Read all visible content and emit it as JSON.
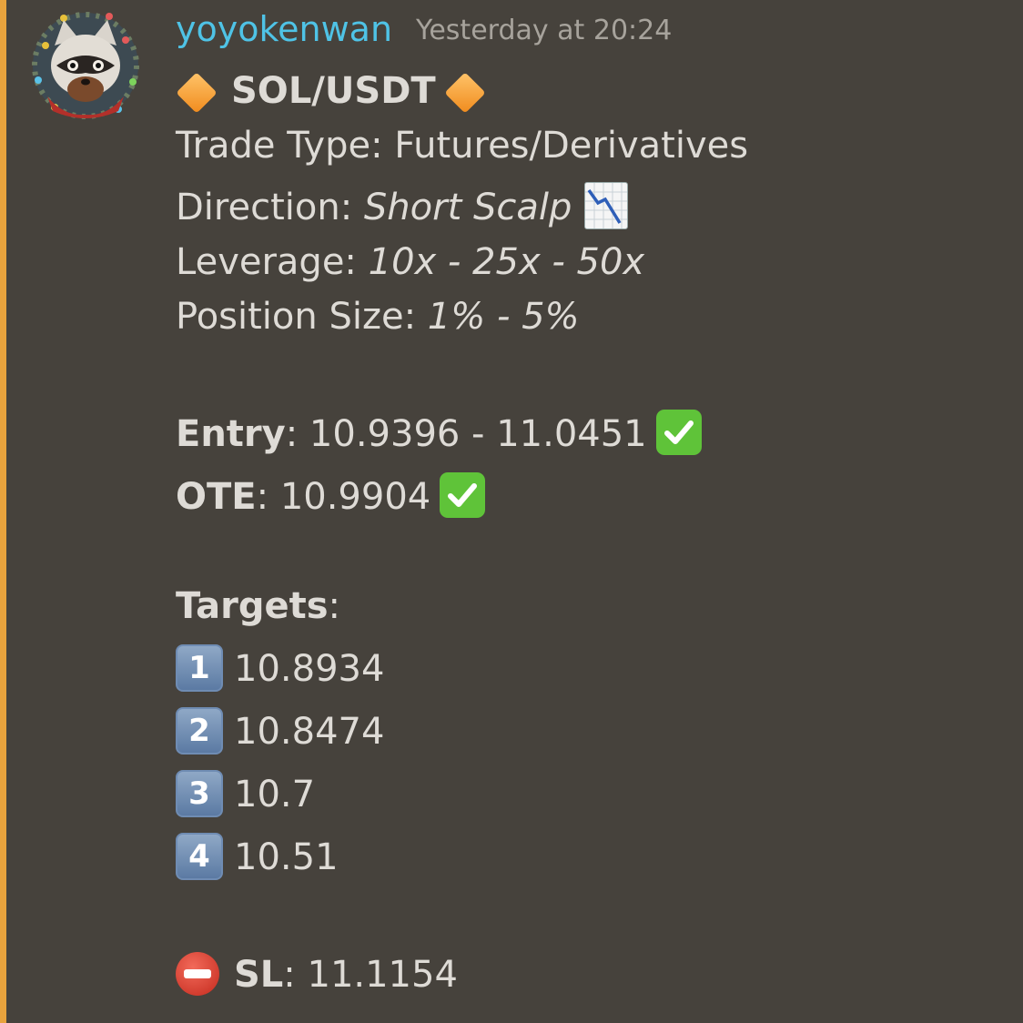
{
  "message": {
    "username": "yoyokenwan",
    "timestamp": "Yesterday at 20:24",
    "pair": "SOL/USDT",
    "trade_type_label": "Trade Type: ",
    "trade_type_value": "Futures/Derivatives",
    "direction_label": "Direction: ",
    "direction_value": "Short Scalp",
    "leverage_label": "Leverage: ",
    "leverage_value": "10x - 25x - 50x",
    "position_label": "Position Size: ",
    "position_value": "1% - 5%",
    "entry_label": "Entry",
    "entry_value": ": 10.9396 - 11.0451",
    "ote_label": "OTE",
    "ote_value": ": 10.9904",
    "targets_label": "Targets",
    "targets_colon": ":",
    "targets": [
      {
        "num": "1",
        "value": "10.8934"
      },
      {
        "num": "2",
        "value": "10.8474"
      },
      {
        "num": "3",
        "value": "10.7"
      },
      {
        "num": "4",
        "value": "10.51"
      }
    ],
    "sl_label": "SL",
    "sl_value": ": 11.1154"
  },
  "colors": {
    "background": "#46423c",
    "accent_bar": "#e8a33d",
    "username": "#4fc3e6",
    "timestamp": "#a7a39c",
    "text": "#dedbd6"
  },
  "icons": {
    "avatar": "raccoon-avatar-icon",
    "diamond": "orange-diamond-icon",
    "direction": "chart-decreasing-icon",
    "check": "check-mark-button-icon",
    "keycap": "keycap-digit-icon",
    "stop": "no-entry-icon"
  }
}
